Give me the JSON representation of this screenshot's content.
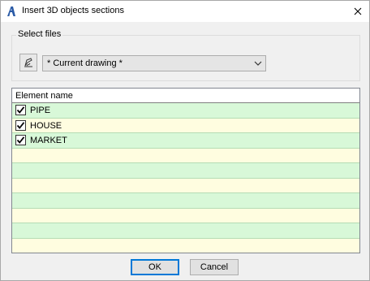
{
  "window": {
    "title": "Insert 3D objects sections",
    "accent_color": "#2a5aa6"
  },
  "select_files": {
    "group_label": "Select files",
    "browse_icon": "pen-drawing-icon",
    "combo_value": "* Current drawing *"
  },
  "list": {
    "header": "Element name",
    "row_colors": {
      "even": "#d8f8d8",
      "odd": "#fffde0"
    },
    "items": [
      {
        "label": "PIPE",
        "checked": true
      },
      {
        "label": "HOUSE",
        "checked": true
      },
      {
        "label": "MARKET",
        "checked": true
      }
    ]
  },
  "buttons": {
    "ok": "OK",
    "cancel": "Cancel"
  }
}
